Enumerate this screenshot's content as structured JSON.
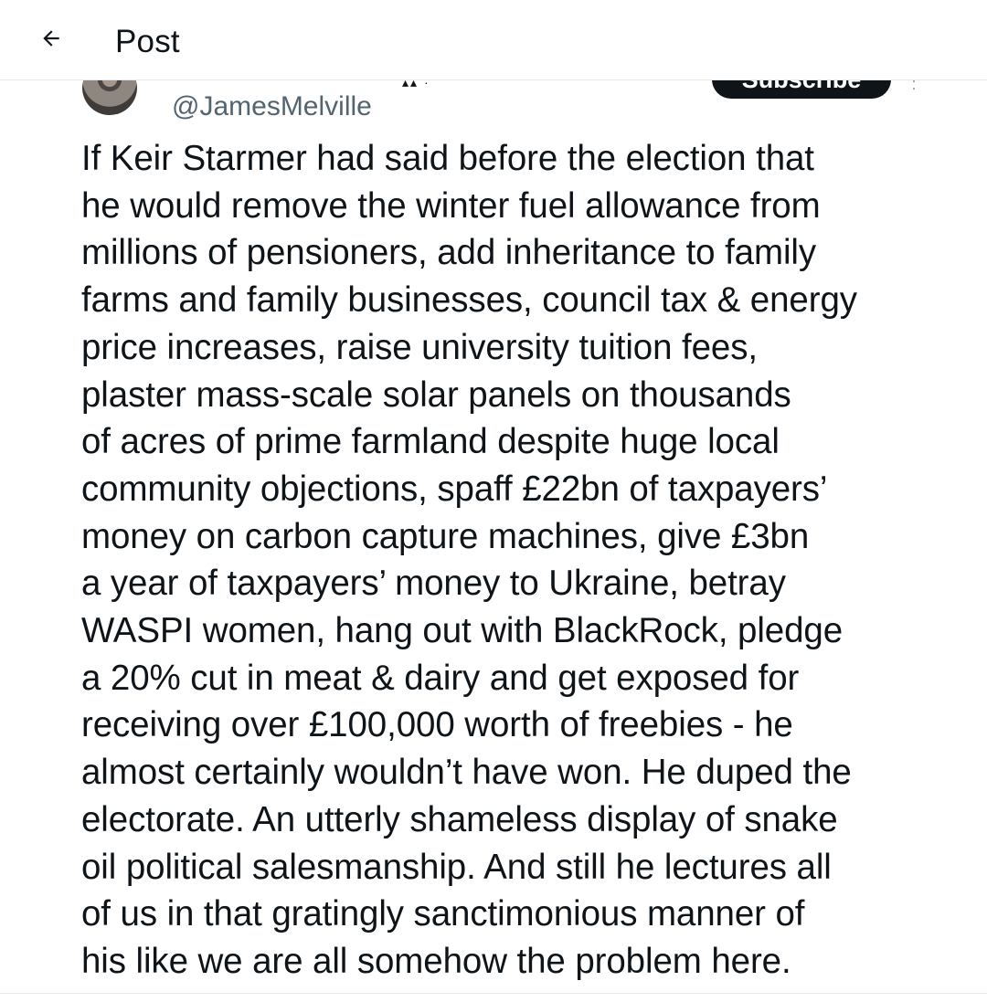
{
  "header": {
    "title": "Post",
    "back_icon": "arrow-left-icon"
  },
  "author": {
    "handle": "@JamesMelville",
    "subscribe_label": "Subscribe",
    "more_icon": "more-vertical-icon"
  },
  "post": {
    "text": "If Keir Starmer had said before the election that\nhe would remove the winter fuel allowance from\nmillions of pensioners, add inheritance to family\nfarms and family businesses, council tax & energy\nprice increases, raise university tuition fees,\nplaster mass-scale solar panels on thousands\nof acres of prime farmland despite huge local\ncommunity objections, spaff £22bn of taxpayers’\nmoney on carbon capture machines, give £3bn\na year of taxpayers’ money to Ukraine, betray\nWASPI women, hang out with BlackRock, pledge\na 20% cut in meat & dairy and get exposed for\nreceiving over £100,000 worth of freebies - he\nalmost certainly wouldn’t have won. He duped the\nelectorate. An utterly shameless display of snake\noil political salesmanship. And still he lectures all\nof us in that gratingly sanctimonious manner of\nhis like we are all somehow the problem here."
  },
  "colors": {
    "text": "#0f1419",
    "secondary": "#536471",
    "divider": "#e7e9ea",
    "button_bg": "#0f1419"
  }
}
